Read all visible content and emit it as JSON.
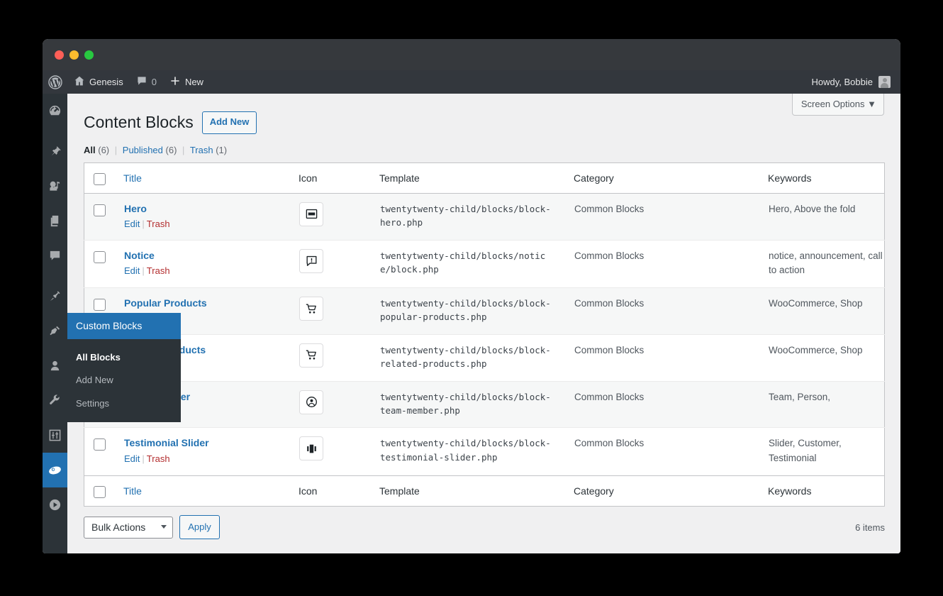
{
  "window": {
    "traffic_lights": [
      "close",
      "minimize",
      "maximize"
    ]
  },
  "adminbar": {
    "wp_logo": "wordpress-logo-icon",
    "site_name": "Genesis",
    "site_icon": "home-icon",
    "comments_icon": "comment-bubble-icon",
    "comments_count": "0",
    "new_icon": "plus-icon",
    "new_label": "New",
    "howdy": "Howdy, Bobbie",
    "avatar": "user-avatar"
  },
  "sidebar": {
    "items": [
      {
        "name": "dashboard",
        "icon": "dashboard-icon"
      },
      {
        "name": "posts",
        "icon": "pin-icon"
      },
      {
        "name": "media",
        "icon": "media-icon"
      },
      {
        "name": "pages",
        "icon": "pages-icon"
      },
      {
        "name": "comments",
        "icon": "comment-icon"
      },
      {
        "name": "appearance",
        "icon": "paintbrush-icon"
      },
      {
        "name": "plugins",
        "icon": "plugin-icon"
      },
      {
        "name": "users",
        "icon": "user-icon"
      },
      {
        "name": "tools",
        "icon": "wrench-icon"
      },
      {
        "name": "settings",
        "icon": "sliders-icon"
      },
      {
        "name": "custom-blocks",
        "icon": "genesis-blocks-icon",
        "current": true
      },
      {
        "name": "media-player",
        "icon": "play-circle-icon"
      }
    ]
  },
  "flyout": {
    "title": "Custom Blocks",
    "items": [
      {
        "label": "All Blocks",
        "active": true
      },
      {
        "label": "Add New",
        "active": false
      },
      {
        "label": "Settings",
        "active": false
      }
    ]
  },
  "screen_options": {
    "label": "Screen Options",
    "caret": "▼"
  },
  "page": {
    "title": "Content Blocks",
    "add_new": "Add New"
  },
  "filters": {
    "items": [
      {
        "label": "All",
        "count": "(6)",
        "current": true
      },
      {
        "label": "Published",
        "count": "(6)",
        "current": false
      },
      {
        "label": "Trash",
        "count": "(1)",
        "current": false
      }
    ],
    "separator": "|"
  },
  "table": {
    "columns": [
      "Title",
      "Icon",
      "Template",
      "Category",
      "Keywords"
    ],
    "actions": {
      "edit": "Edit",
      "trash": "Trash",
      "separator": "|"
    },
    "rows": [
      {
        "title": "Hero",
        "icon": "cover-layout-icon",
        "template": "twentytwenty-child/blocks/block-hero.php",
        "category": "Common Blocks",
        "keywords": "Hero, Above the fold"
      },
      {
        "title": "Notice",
        "icon": "notice-bubble-icon",
        "template": "twentytwenty-child/blocks/notice/block.php",
        "category": "Common Blocks",
        "keywords": "notice, announcement, call to action"
      },
      {
        "title": "Popular Products",
        "icon": "shopping-cart-icon",
        "template": "twentytwenty-child/blocks/block-popular-products.php",
        "category": "Common Blocks",
        "keywords": "WooCommerce, Shop"
      },
      {
        "title": "Related Products",
        "icon": "shopping-cart-icon",
        "template": "twentytwenty-child/blocks/block-related-products.php",
        "category": "Common Blocks",
        "keywords": "WooCommerce, Shop"
      },
      {
        "title": "Team Member",
        "icon": "person-circle-icon",
        "template": "twentytwenty-child/blocks/block-team-member.php",
        "category": "Common Blocks",
        "keywords": "Team, Person,"
      },
      {
        "title": "Testimonial Slider",
        "icon": "carousel-icon",
        "template": "twentytwenty-child/blocks/block-testimonial-slider.php",
        "category": "Common Blocks",
        "keywords": "Slider, Customer, Testimonial"
      }
    ]
  },
  "tablenav": {
    "bulk_actions": "Bulk Actions",
    "apply": "Apply",
    "item_count": "6 items"
  },
  "colors": {
    "accent": "#2271b1",
    "sidebar_bg": "#2c3338",
    "adminbar_bg": "#33373d",
    "trash_red": "#b32d2e",
    "page_bg": "#f0f0f1"
  }
}
